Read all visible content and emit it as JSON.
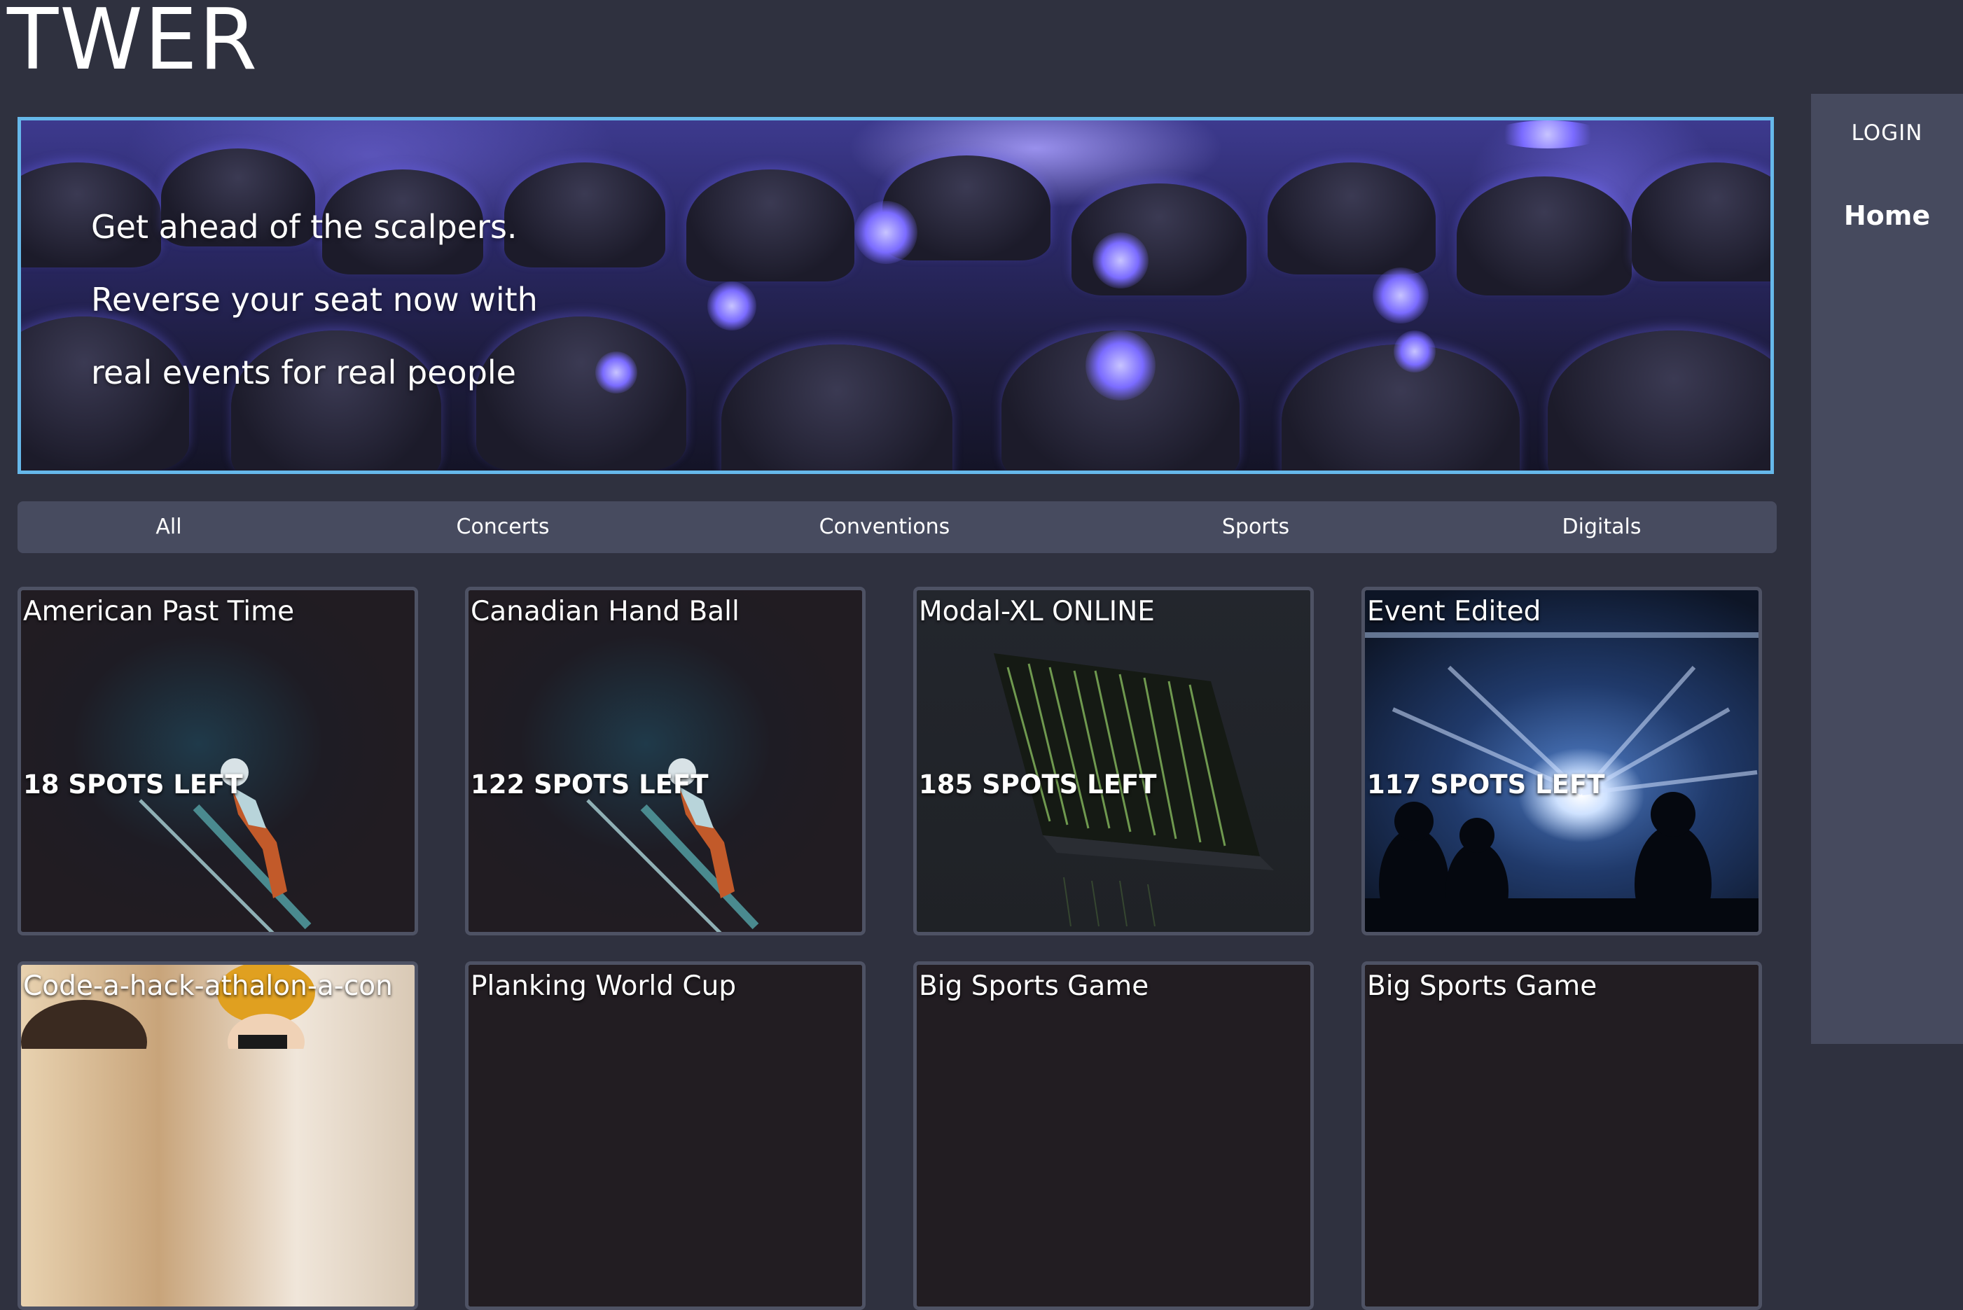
{
  "app": {
    "logo": "TWER"
  },
  "sidebar": {
    "login": "LOGIN",
    "home": "Home"
  },
  "hero": {
    "lines": [
      "Get ahead of the scalpers.",
      "Reverse your seat now with",
      "real events for real people"
    ]
  },
  "tabs": [
    "All",
    "Concerts",
    "Conventions",
    "Sports",
    "Digitals"
  ],
  "events": [
    {
      "title": "American Past Time",
      "spots": "18 SPOTS LEFT",
      "image": "ski-jumper"
    },
    {
      "title": "Canadian Hand Ball",
      "spots": "122 SPOTS LEFT",
      "image": "ski-jumper"
    },
    {
      "title": "Modal-XL ONLINE",
      "spots": "185 SPOTS LEFT",
      "image": "laptop-code"
    },
    {
      "title": "Event Edited",
      "spots": "117 SPOTS LEFT",
      "image": "concert-stage"
    },
    {
      "title": "Code-a-hack-athalon-a-con",
      "spots": "",
      "image": "people"
    },
    {
      "title": "Planking World Cup",
      "spots": "",
      "image": "dark"
    },
    {
      "title": "Big Sports Game",
      "spots": "",
      "image": "dark"
    },
    {
      "title": "Big Sports Game",
      "spots": "",
      "image": "dark"
    }
  ],
  "colors": {
    "background": "#2f313f",
    "sidebar": "#464a5e",
    "tab_bar": "#474b5f",
    "hero_border": "#66b8ea",
    "card_border": "#4e5264"
  }
}
